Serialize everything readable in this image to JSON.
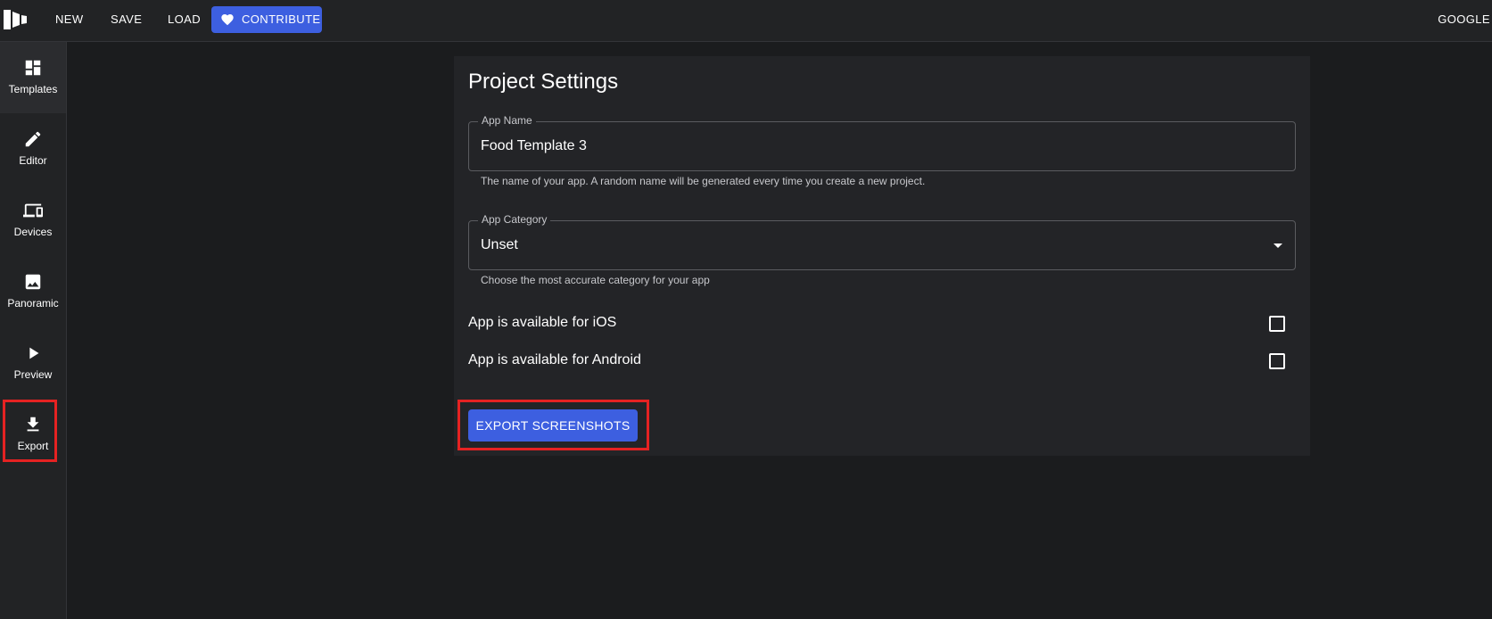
{
  "topbar": {
    "logo_icon": "app-logo-icon",
    "new_label": "NEW",
    "save_label": "SAVE",
    "load_label": "LOAD",
    "contribute_label": "CONTRIBUTE",
    "contribute_icon": "heart-icon",
    "account_label": "GOOGLE",
    "accent_color": "#3d5fe0"
  },
  "sidebar": {
    "items": [
      {
        "label": "Templates",
        "icon": "dashboard-icon"
      },
      {
        "label": "Editor",
        "icon": "pencil-icon"
      },
      {
        "label": "Devices",
        "icon": "devices-icon"
      },
      {
        "label": "Panoramic",
        "icon": "image-icon"
      },
      {
        "label": "Preview",
        "icon": "play-icon"
      },
      {
        "label": "Export",
        "icon": "download-icon"
      }
    ],
    "active_index": 0,
    "highlight_color": "#e52222"
  },
  "settings": {
    "title": "Project Settings",
    "app_name": {
      "label": "App Name",
      "value": "Food Template 3",
      "helper": "The name of your app. A random name will be generated every time you create a new project."
    },
    "app_category": {
      "label": "App Category",
      "value": "Unset",
      "helper": "Choose the most accurate category for your app"
    },
    "ios": {
      "label": "App is available for iOS",
      "checked": false
    },
    "android": {
      "label": "App is available for Android",
      "checked": false
    },
    "export_label": "EXPORT SCREENSHOTS"
  }
}
